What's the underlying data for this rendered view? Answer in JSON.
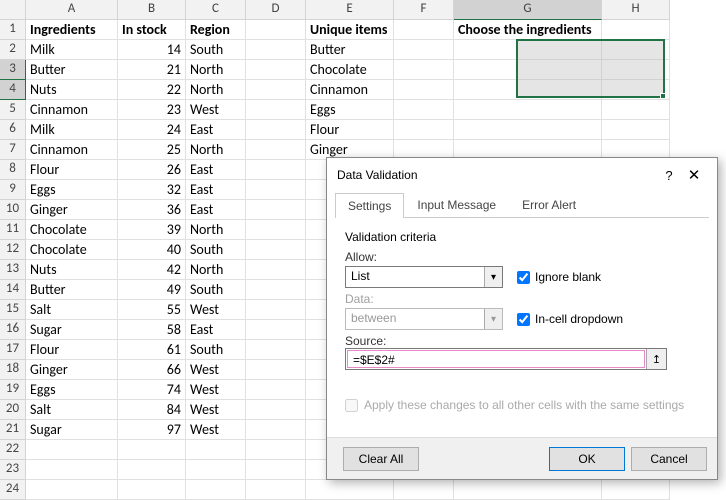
{
  "cols": [
    "",
    "A",
    "B",
    "C",
    "D",
    "E",
    "F",
    "G",
    "H"
  ],
  "headers": {
    "A": "Ingredients",
    "B": "In stock",
    "C": "Region",
    "E": "Unique items",
    "G": "Choose the ingredients"
  },
  "rows": [
    {
      "n": 1
    },
    {
      "n": 2,
      "A": "Milk",
      "B": 14,
      "C": "South",
      "E": "Butter"
    },
    {
      "n": 3,
      "A": "Butter",
      "B": 21,
      "C": "North",
      "E": "Chocolate"
    },
    {
      "n": 4,
      "A": "Nuts",
      "B": 22,
      "C": "North",
      "E": "Cinnamon"
    },
    {
      "n": 5,
      "A": "Cinnamon",
      "B": 23,
      "C": "West",
      "E": "Eggs"
    },
    {
      "n": 6,
      "A": "Milk",
      "B": 24,
      "C": "East",
      "E": "Flour"
    },
    {
      "n": 7,
      "A": "Cinnamon",
      "B": 25,
      "C": "North",
      "E": "Ginger"
    },
    {
      "n": 8,
      "A": "Flour",
      "B": 26,
      "C": "East"
    },
    {
      "n": 9,
      "A": "Eggs",
      "B": 32,
      "C": "East"
    },
    {
      "n": 10,
      "A": "Ginger",
      "B": 36,
      "C": "East"
    },
    {
      "n": 11,
      "A": "Chocolate",
      "B": 39,
      "C": "North"
    },
    {
      "n": 12,
      "A": "Chocolate",
      "B": 40,
      "C": "South"
    },
    {
      "n": 13,
      "A": "Nuts",
      "B": 42,
      "C": "North"
    },
    {
      "n": 14,
      "A": "Butter",
      "B": 49,
      "C": "South"
    },
    {
      "n": 15,
      "A": "Salt",
      "B": 55,
      "C": "West"
    },
    {
      "n": 16,
      "A": "Sugar",
      "B": 58,
      "C": "East"
    },
    {
      "n": 17,
      "A": "Flour",
      "B": 61,
      "C": "South"
    },
    {
      "n": 18,
      "A": "Ginger",
      "B": 66,
      "C": "West"
    },
    {
      "n": 19,
      "A": "Eggs",
      "B": 74,
      "C": "West"
    },
    {
      "n": 20,
      "A": "Salt",
      "B": 84,
      "C": "West"
    },
    {
      "n": 21,
      "A": "Sugar",
      "B": 97,
      "C": "West"
    },
    {
      "n": 22
    },
    {
      "n": 23
    },
    {
      "n": 24
    }
  ],
  "dialog": {
    "title": "Data Validation",
    "tabs": [
      "Settings",
      "Input Message",
      "Error Alert"
    ],
    "active_tab": 0,
    "legend": "Validation criteria",
    "allow_label": "Allow:",
    "allow_value": "List",
    "data_label": "Data:",
    "data_value": "between",
    "source_label": "Source:",
    "source_value": "=$E$2#",
    "ignore_blank": "Ignore blank",
    "incell_dd": "In-cell dropdown",
    "apply_same": "Apply these changes to all other cells with the same settings",
    "clear_all": "Clear All",
    "ok": "OK",
    "cancel": "Cancel"
  }
}
